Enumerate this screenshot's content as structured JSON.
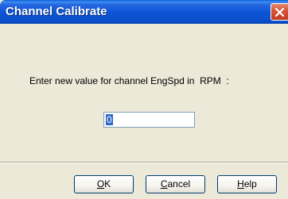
{
  "window": {
    "title": "Channel Calibrate"
  },
  "icons": {
    "close": "close-icon"
  },
  "prompt": {
    "text": "Enter new value for channel EngSpd in  RPM  :"
  },
  "input": {
    "value": "0"
  },
  "buttons": {
    "ok": {
      "mnemonic": "O",
      "rest": "K"
    },
    "cancel": {
      "mnemonic": "C",
      "rest": "ancel"
    },
    "help": {
      "mnemonic": "H",
      "rest": "elp"
    }
  },
  "colors": {
    "title_bar": "#0b54d6",
    "close_button": "#c23a1e",
    "dialog_bg": "#ece9d8"
  }
}
